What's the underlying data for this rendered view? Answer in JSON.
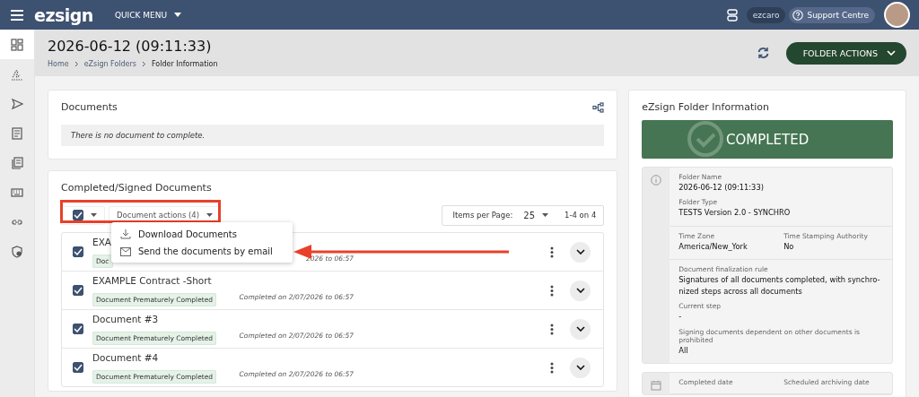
{
  "topbar": {
    "logo": "ezsign",
    "quick_menu": "QUICK MENU",
    "user": "ezcaro",
    "support": "Support Centre"
  },
  "sidebar": {
    "items": [
      {
        "selected": true
      },
      {
        "selected": false
      },
      {
        "selected": false
      },
      {
        "selected": false
      },
      {
        "selected": false
      },
      {
        "selected": false
      },
      {
        "selected": false
      },
      {
        "selected": false
      }
    ]
  },
  "header": {
    "title": "2026-06-12 (09:11:33)",
    "breadcrumbs": [
      "Home",
      "eZsign Folders",
      "Folder Information"
    ],
    "folder_actions": "FOLDER ACTIONS"
  },
  "documents": {
    "title": "Documents",
    "message": "There is no document to complete."
  },
  "completed": {
    "title": "Completed/Signed Documents",
    "select_all_checked": true,
    "document_actions": "Document actions (4)",
    "menu": [
      {
        "kind": "download",
        "label": "Download Documents"
      },
      {
        "kind": "email",
        "label": "Send the documents by email"
      }
    ],
    "items_per_page_label": "Items per Page:",
    "items_per_page": "25",
    "range": "1-4 on 4",
    "rows": [
      {
        "checked": true,
        "title": "EXA",
        "badge": "Doc",
        "date": "2026 to 06:57"
      },
      {
        "checked": true,
        "title": "EXAMPLE Contract -Short",
        "badge": "Document Prematurely Completed",
        "date": "Completed on 2/07/2026 to 06:57"
      },
      {
        "checked": true,
        "title": "Document #3",
        "badge": "Document Prematurely Completed",
        "date": "Completed on 2/07/2026 to 06:57"
      },
      {
        "checked": true,
        "title": "Document #4",
        "badge": "Document Prematurely Completed",
        "date": "Completed on 2/07/2026 to 06:57"
      }
    ]
  },
  "folder_info": {
    "title": "eZsign Folder Information",
    "status": "COMPLETED",
    "fields": [
      {
        "label": "Folder Name",
        "value": "2026-06-12 (09:11:33)"
      },
      {
        "label": "Folder Type",
        "value": "TESTS Version 2.0 - SYNCHRO"
      }
    ],
    "pair": [
      {
        "label": "Time Zone",
        "value": "America/New_York"
      },
      {
        "label": "Time Stamping Authority",
        "value": "No"
      }
    ],
    "rules": [
      {
        "label": "Document finalization rule",
        "value": "Signatures of all documents completed, with synchro-nized steps across all documents"
      },
      {
        "label": "Current step",
        "value": "-"
      },
      {
        "label": "Signing documents dependent on other documents is prohibited",
        "value": "All"
      }
    ],
    "dates": [
      {
        "label": "Completed date"
      },
      {
        "label": "Scheduled archiving date"
      }
    ]
  }
}
